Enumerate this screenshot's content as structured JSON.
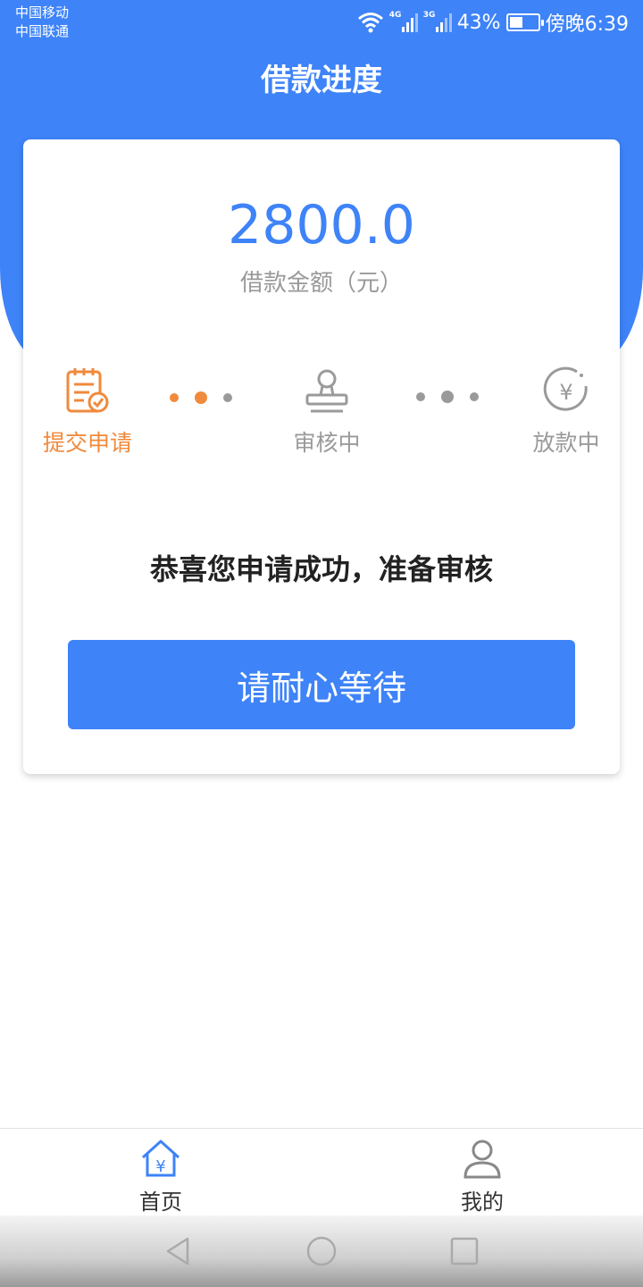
{
  "status": {
    "carrier1": "中国移动",
    "carrier2": "中国联通",
    "sig1_label": "4G",
    "sig2_label": "3G",
    "battery": "43%",
    "time": "傍晚6:39"
  },
  "header": {
    "title": "借款进度"
  },
  "card": {
    "amount": "2800.0",
    "amount_label": "借款金额（元）",
    "steps": [
      {
        "label": "提交申请",
        "state": "active"
      },
      {
        "label": "审核中",
        "state": "pending"
      },
      {
        "label": "放款中",
        "state": "pending"
      }
    ],
    "message": "恭喜您申请成功，准备审核",
    "button_label": "请耐心等待"
  },
  "tabbar": {
    "items": [
      {
        "label": "首页",
        "icon": "home-yen-icon",
        "active": true
      },
      {
        "label": "我的",
        "icon": "user-icon",
        "active": false
      }
    ]
  },
  "colors": {
    "primary": "#3e83f8",
    "active_step": "#f08a3c",
    "inactive": "#9a9a9a"
  }
}
